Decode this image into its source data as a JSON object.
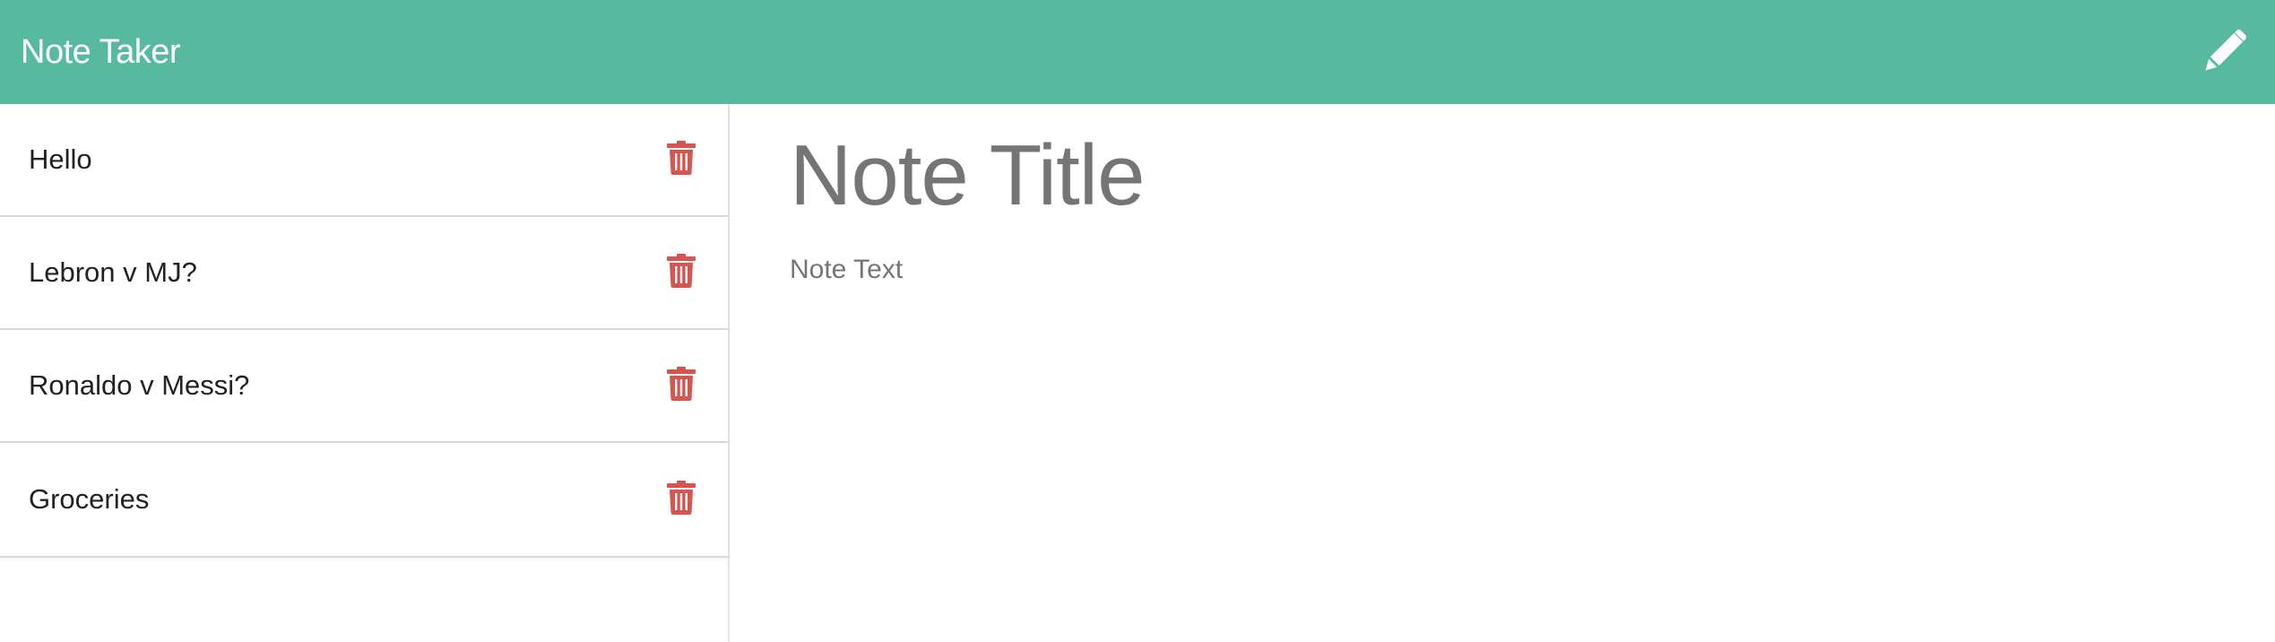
{
  "navbar": {
    "brand": "Note Taker",
    "new_note_icon": "pencil-icon",
    "background_color": "#57ba9f"
  },
  "sidebar": {
    "notes": [
      {
        "title": "Hello",
        "delete_icon": "trash-icon"
      },
      {
        "title": "Lebron v MJ?",
        "delete_icon": "trash-icon"
      },
      {
        "title": "Ronaldo v Messi?",
        "delete_icon": "trash-icon"
      },
      {
        "title": "Groceries",
        "delete_icon": "trash-icon"
      }
    ],
    "delete_icon_color": "#d9534f"
  },
  "editor": {
    "title_placeholder": "Note Title",
    "text_placeholder": "Note Text",
    "title_value": "",
    "text_value": ""
  }
}
